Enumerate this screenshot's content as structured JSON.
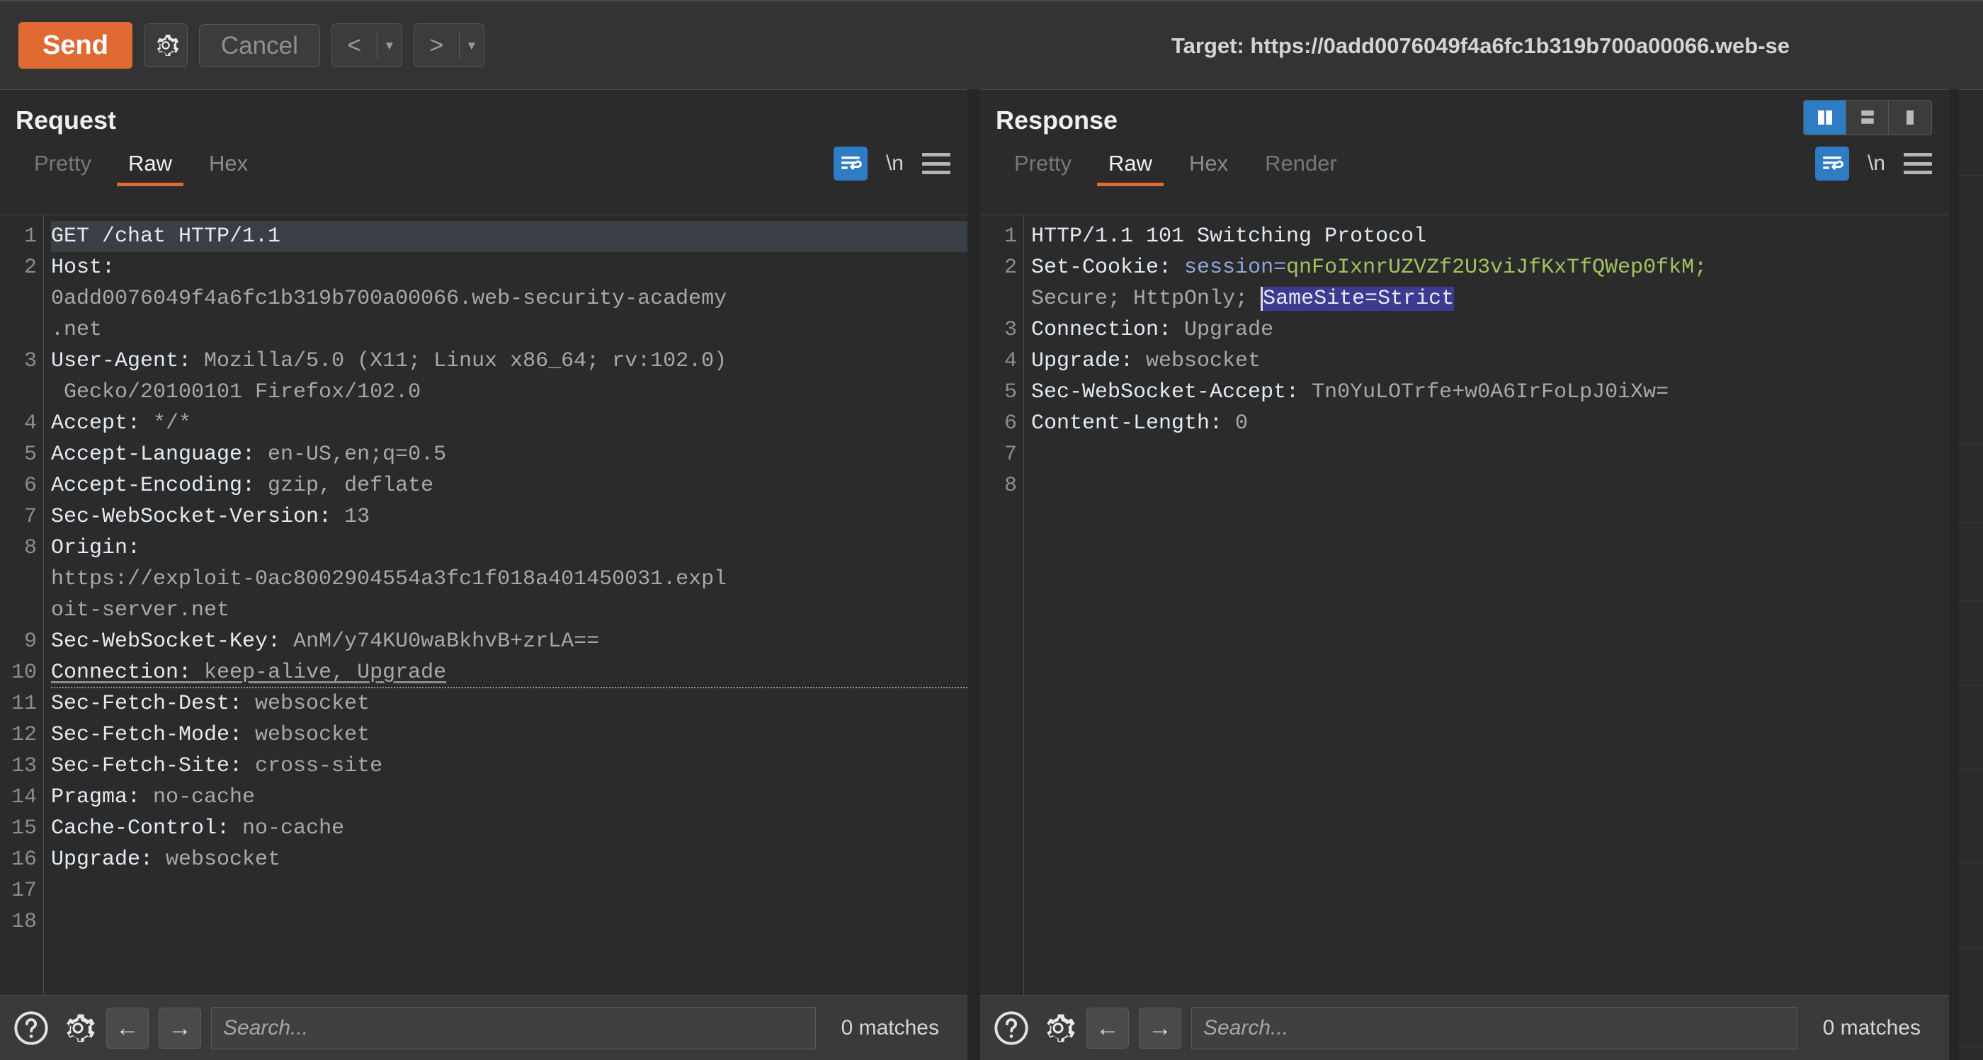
{
  "toolbar": {
    "send_label": "Send",
    "settings_icon": "gear-icon",
    "cancel_label": "Cancel",
    "prev_icon": "chevron-left-icon",
    "next_icon": "chevron-right-icon",
    "caret_icon": "caret-down-icon",
    "target_label": "Target: https://0add0076049f4a6fc1b319b700a00066.web-se",
    "accent_color": "#e06a33"
  },
  "request": {
    "title": "Request",
    "tabs": [
      {
        "label": "Pretty",
        "active": false,
        "dim": true
      },
      {
        "label": "Raw",
        "active": true,
        "dim": false
      },
      {
        "label": "Hex",
        "active": false,
        "dim": false
      }
    ],
    "wrap_icon": "word-wrap-icon",
    "newline_label": "\\n",
    "menu_icon": "hamburger-menu-icon",
    "line_numbers": [
      "1",
      "2",
      "",
      "",
      "3",
      "",
      "4",
      "5",
      "6",
      "7",
      "8",
      "",
      "",
      "9",
      "10",
      "11",
      "12",
      "13",
      "14",
      "15",
      "16",
      "17",
      "18"
    ],
    "lines": [
      {
        "n": "1",
        "header": "GET /chat HTTP/1.1",
        "value": "",
        "highlight": true
      },
      {
        "n": "2",
        "header": "Host:",
        "value": ""
      },
      {
        "n": "",
        "header": "",
        "value": "0add0076049f4a6fc1b319b700a00066.web-security-academy"
      },
      {
        "n": "",
        "header": "",
        "value": ".net"
      },
      {
        "n": "3",
        "header": "User-Agent:",
        "value": " Mozilla/5.0 (X11; Linux x86_64; rv:102.0)"
      },
      {
        "n": "",
        "header": "",
        "value": " Gecko/20100101 Firefox/102.0"
      },
      {
        "n": "4",
        "header": "Accept:",
        "value": " */*"
      },
      {
        "n": "5",
        "header": "Accept-Language:",
        "value": " en-US,en;q=0.5"
      },
      {
        "n": "6",
        "header": "Accept-Encoding:",
        "value": " gzip, deflate"
      },
      {
        "n": "7",
        "header": "Sec-WebSocket-Version:",
        "value": " 13"
      },
      {
        "n": "8",
        "header": "Origin:",
        "value": ""
      },
      {
        "n": "",
        "header": "",
        "value": "https://exploit-0ac8002904554a3fc1f018a401450031.expl"
      },
      {
        "n": "",
        "header": "",
        "value": "oit-server.net"
      },
      {
        "n": "9",
        "header": "Sec-WebSocket-Key:",
        "value": " AnM/y74KU0waBkhvB+zrLA=="
      },
      {
        "n": "10",
        "header": "Connection:",
        "value": " keep-alive, Upgrade",
        "dotted": true
      },
      {
        "n": "11",
        "header": "Sec-Fetch-Dest:",
        "value": " websocket"
      },
      {
        "n": "12",
        "header": "Sec-Fetch-Mode:",
        "value": " websocket"
      },
      {
        "n": "13",
        "header": "Sec-Fetch-Site:",
        "value": " cross-site"
      },
      {
        "n": "14",
        "header": "Pragma:",
        "value": " no-cache"
      },
      {
        "n": "15",
        "header": "Cache-Control:",
        "value": " no-cache"
      },
      {
        "n": "16",
        "header": "Upgrade:",
        "value": " websocket"
      },
      {
        "n": "17",
        "header": "",
        "value": ""
      },
      {
        "n": "18",
        "header": "",
        "value": ""
      }
    ],
    "search": {
      "help_icon": "help-circle-icon",
      "settings_icon": "gear-icon",
      "prev_icon": "arrow-left-icon",
      "next_icon": "arrow-right-icon",
      "placeholder": "Search...",
      "value": "",
      "matches": "0 matches"
    }
  },
  "response": {
    "title": "Response",
    "tabs": [
      {
        "label": "Pretty",
        "active": false,
        "dim": true
      },
      {
        "label": "Raw",
        "active": true,
        "dim": false
      },
      {
        "label": "Hex",
        "active": false,
        "dim": false
      },
      {
        "label": "Render",
        "active": false,
        "dim": true
      }
    ],
    "wrap_icon": "word-wrap-icon",
    "newline_label": "\\n",
    "menu_icon": "hamburger-menu-icon",
    "layout_buttons": [
      {
        "name": "layout-side-by-side",
        "active": true
      },
      {
        "name": "layout-stacked",
        "active": false
      },
      {
        "name": "layout-single",
        "active": false
      }
    ],
    "lines": [
      {
        "n": "1",
        "header": "HTTP/1.1 101 Switching Protocol",
        "value": ""
      },
      {
        "n": "2",
        "header": "Set-Cookie:",
        "cookie_name": " session=",
        "cookie_value": "qnFoIxnrUZVZf2U3viJfKxTfQWep0fkM;"
      },
      {
        "n": "",
        "header": "",
        "value": "Secure; HttpOnly; ",
        "selected": "SameSite=Strict"
      },
      {
        "n": "3",
        "header": "Connection:",
        "value": " Upgrade"
      },
      {
        "n": "4",
        "header": "Upgrade:",
        "value": " websocket"
      },
      {
        "n": "5",
        "header": "Sec-WebSocket-Accept:",
        "value": " Tn0YuLOTrfe+w0A6IrFoLpJ0iXw="
      },
      {
        "n": "6",
        "header": "Content-Length:",
        "value": " 0"
      },
      {
        "n": "7",
        "header": "",
        "value": ""
      },
      {
        "n": "8",
        "header": "",
        "value": ""
      }
    ],
    "search": {
      "help_icon": "help-circle-icon",
      "settings_icon": "gear-icon",
      "prev_icon": "arrow-left-icon",
      "next_icon": "arrow-right-icon",
      "placeholder": "Search...",
      "value": "",
      "matches": "0 matches"
    }
  }
}
